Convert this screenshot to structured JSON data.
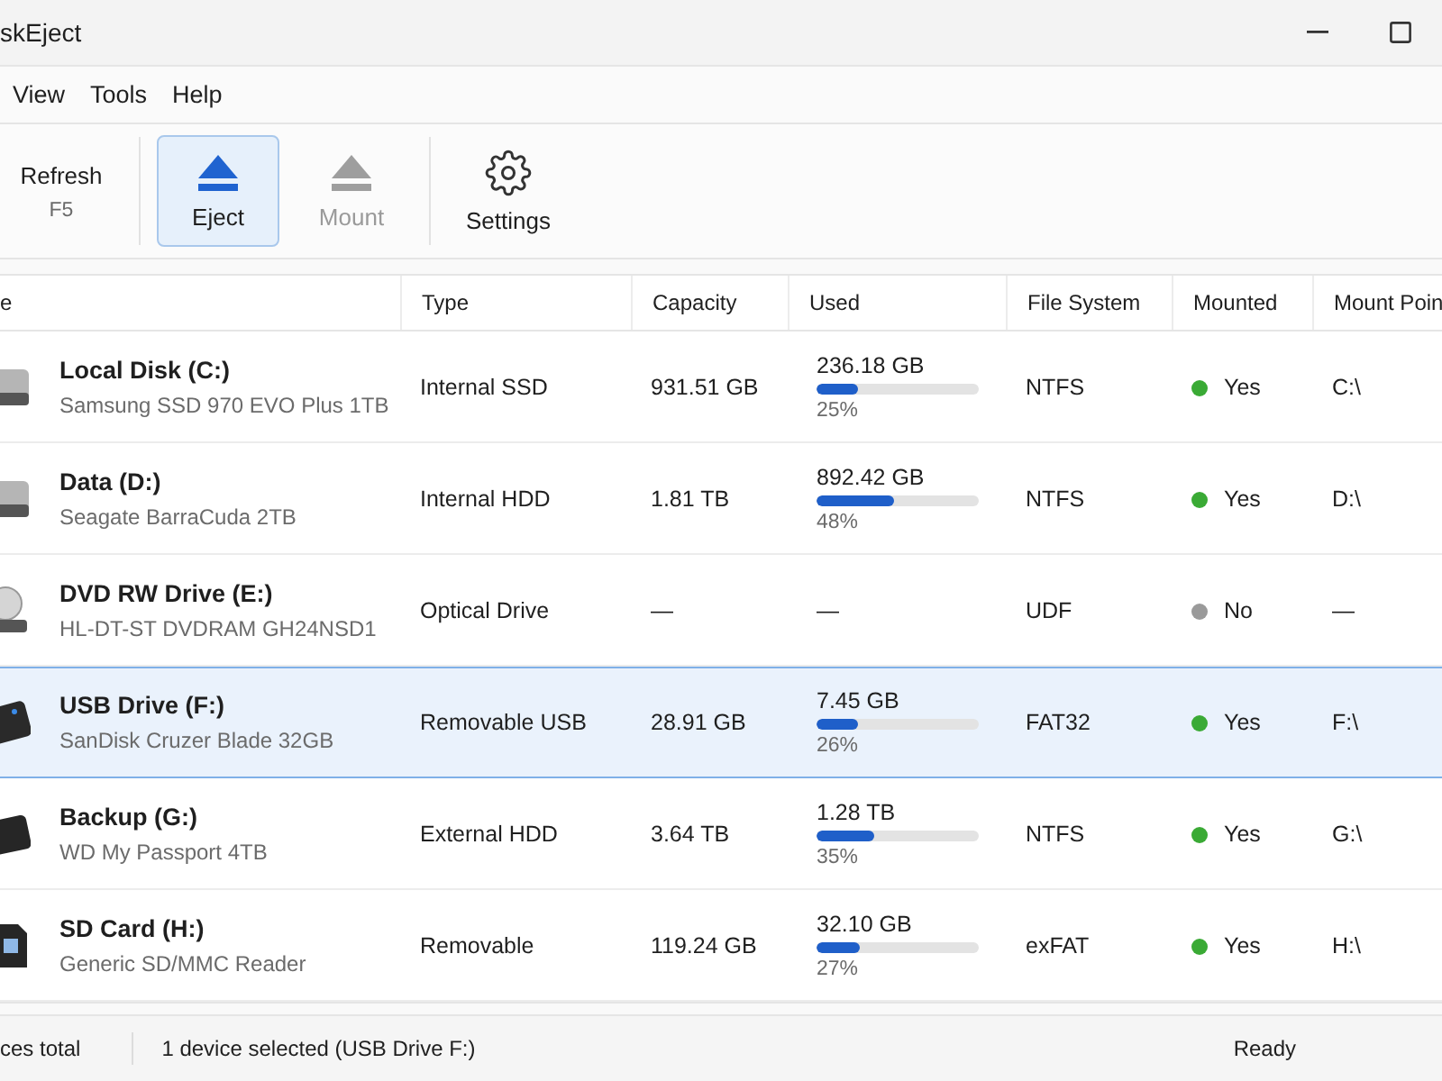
{
  "window": {
    "title": "skEject"
  },
  "menu": [
    {
      "label": "View"
    },
    {
      "label": "Tools"
    },
    {
      "label": "Help"
    }
  ],
  "toolbar": [
    {
      "kind": "text",
      "label": "Refresh",
      "shortcut": "F5",
      "selected": false,
      "disabled": false
    },
    {
      "kind": "eject",
      "label": "Eject",
      "selected": true,
      "disabled": false
    },
    {
      "kind": "eject",
      "label": "Mount",
      "selected": false,
      "disabled": true
    },
    {
      "kind": "gear",
      "label": "Settings",
      "selected": false,
      "disabled": false
    }
  ],
  "table": {
    "columns": [
      "e",
      "Type",
      "Capacity",
      "Used",
      "File System",
      "Mounted",
      "Mount Poin"
    ],
    "rows": [
      {
        "kind": "ssd",
        "name": "Local Disk (C:)",
        "model": "Samsung SSD 970 EVO Plus 1TB",
        "type": "Internal SSD",
        "capacity": "931.51 GB",
        "used": "236.18 GB",
        "level": 0.25,
        "percent": "25%",
        "fs": "NTFS",
        "mounted": true,
        "mounted_label": "Yes",
        "mount_point": "C:\\",
        "selected": false
      },
      {
        "kind": "hdd",
        "name": "Data (D:)",
        "model": "Seagate BarraCuda 2TB",
        "type": "Internal HDD",
        "capacity": "1.81 TB",
        "used": "892.42 GB",
        "level": 0.48,
        "percent": "48%",
        "fs": "NTFS",
        "mounted": true,
        "mounted_label": "Yes",
        "mount_point": "D:\\",
        "selected": false
      },
      {
        "kind": "optical",
        "name": "DVD RW Drive (E:)",
        "model": "HL-DT-ST DVDRAM GH24NSD1",
        "type": "Optical Drive",
        "capacity": "—",
        "used": "—",
        "fs": "UDF",
        "mounted": false,
        "mounted_label": "No",
        "mount_point": "—",
        "selected": false
      },
      {
        "kind": "usb",
        "name": "USB Drive (F:)",
        "model": "SanDisk Cruzer Blade 32GB",
        "type": "Removable USB",
        "capacity": "28.91 GB",
        "used": "7.45 GB",
        "level": 0.26,
        "percent": "26%",
        "fs": "FAT32",
        "mounted": true,
        "mounted_label": "Yes",
        "mount_point": "F:\\",
        "selected": true
      },
      {
        "kind": "external",
        "name": "Backup (G:)",
        "model": "WD My Passport 4TB",
        "type": "External HDD",
        "capacity": "3.64 TB",
        "used": "1.28 TB",
        "level": 0.35,
        "percent": "35%",
        "fs": "NTFS",
        "mounted": true,
        "mounted_label": "Yes",
        "mount_point": "G:\\",
        "selected": false
      },
      {
        "kind": "sd",
        "name": "SD Card (H:)",
        "model": "Generic SD/MMC Reader",
        "type": "Removable",
        "capacity": "119.24 GB",
        "used": "32.10 GB",
        "level": 0.27,
        "percent": "27%",
        "fs": "exFAT",
        "mounted": true,
        "mounted_label": "Yes",
        "mount_point": "H:\\",
        "selected": false
      }
    ]
  },
  "status_bar": {
    "total": "ces total",
    "selection": "1 device selected (USB Drive F:)",
    "state": "Ready"
  }
}
